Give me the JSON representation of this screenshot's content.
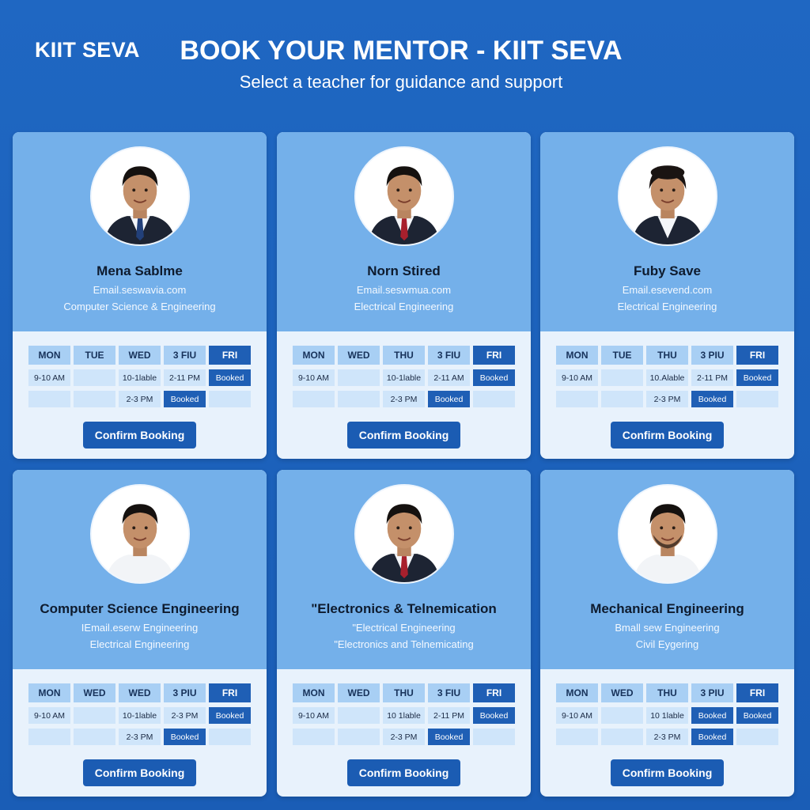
{
  "header": {
    "brand": "KIIT SEVA",
    "title": "BOOK YOUR MENTOR - KIIT SEVA",
    "subtitle": "Select a teacher for guidance and support"
  },
  "colors": {
    "background": "#1f67c2",
    "card_top": "#74b0ea",
    "card_bottom": "#e8f2fc",
    "accent": "#1b5cb3"
  },
  "cards": [
    {
      "name": "Mena Sablme",
      "line1": "Email.seswavia.com",
      "line2": "Computer Science & Engineering",
      "avatar_icon": "mentor-avatar-male-blue-tie",
      "days": [
        "MON",
        "TUE",
        "WED",
        "3 FIU",
        "FRI"
      ],
      "row1": [
        "9-10 AM",
        "",
        "10-1lable",
        "2-11 PM",
        "Booked"
      ],
      "row2": [
        "",
        "",
        "2-3 PM",
        "Booked",
        ""
      ],
      "button": "Confirm Booking"
    },
    {
      "name": "Norn Stired",
      "line1": "Email.seswmua.com",
      "line2": "Electrical Engineering",
      "avatar_icon": "mentor-avatar-male-red-tie",
      "days": [
        "MON",
        "WED",
        "THU",
        "3 FIU",
        "FRI"
      ],
      "row1": [
        "9-10 AM",
        "",
        "10-1lable",
        "2-11 AM",
        "Booked"
      ],
      "row2": [
        "",
        "",
        "2-3 PM",
        "Booked",
        ""
      ],
      "button": "Confirm Booking"
    },
    {
      "name": "Fuby Save",
      "line1": "Email.esevend.com",
      "line2": "Electrical Engineering",
      "avatar_icon": "mentor-avatar-female",
      "days": [
        "MON",
        "TUE",
        "THU",
        "3 PIU",
        "FRI"
      ],
      "row1": [
        "9-10 AM",
        "",
        "10.Alable",
        "2-11 PM",
        "Booked"
      ],
      "row2": [
        "",
        "",
        "2-3 PM",
        "Booked",
        ""
      ],
      "button": "Confirm Booking"
    },
    {
      "name": "Computer Science Engineering",
      "line1": "IEmail.eserw Engineering",
      "line2": "Electrical Engineering",
      "avatar_icon": "mentor-avatar-male-shirt",
      "days": [
        "MON",
        "WED",
        "WED",
        "3 PIU",
        "FRI"
      ],
      "row1": [
        "9-10 AM",
        "",
        "10-1lable",
        "2-3 PM",
        "Booked"
      ],
      "row2": [
        "",
        "",
        "2-3 PM",
        "Booked",
        ""
      ],
      "button": "Confirm Booking"
    },
    {
      "name": "\"Electronics & Telnemication",
      "line1": "\"Electrical Engineering",
      "line2": "\"Electronics and Telnemicating",
      "avatar_icon": "mentor-avatar-male-red-tie",
      "days": [
        "MON",
        "WED",
        "THU",
        "3 FIU",
        "FRI"
      ],
      "row1": [
        "9-10 AM",
        "",
        "10 1lable",
        "2-11 PM",
        "Booked"
      ],
      "row2": [
        "",
        "",
        "2-3 PM",
        "Booked",
        ""
      ],
      "button": "Confirm Booking"
    },
    {
      "name": "Mechanical Engineering",
      "line1": "Bmall sew Engineering",
      "line2": "Civil Eygering",
      "avatar_icon": "mentor-avatar-male-beard",
      "days": [
        "MON",
        "WED",
        "THU",
        "3 PIU",
        "FRI"
      ],
      "row1": [
        "9-10 AM",
        "",
        "10 1lable",
        "Booked",
        "Booked"
      ],
      "row2": [
        "",
        "",
        "2-3 PM",
        "Booked",
        ""
      ],
      "button": "Confirm Booking"
    }
  ]
}
